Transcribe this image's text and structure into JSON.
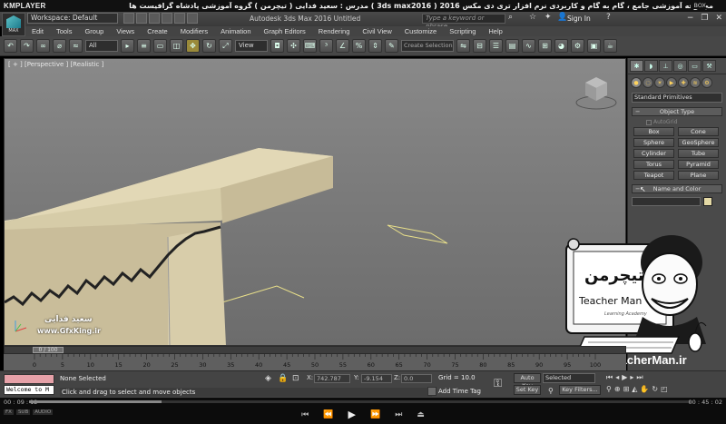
{
  "player": {
    "brand": "KMPLAYER",
    "title": "مجموعه آموزشی جامع ، گام به گام و کاربردی نرم افزار تری دی مکس 2016 ( 3ds max2016 )  مدرس : سعید فدایی ( تیچرمن ) گروه آموزشی پادشاه گرافیست ها",
    "time_current": "00 : 09 : 12",
    "time_total": "00 : 45 : 02",
    "progress_fraction": 0.2,
    "corner_label": "BOX",
    "controls": [
      "⏮",
      "⏪",
      "▶",
      "⏩",
      "⏭",
      "⏏"
    ],
    "left_badges": [
      "FX",
      "SUB",
      "AUDIO"
    ]
  },
  "app": {
    "window_title": "Autodesk 3ds Max 2016     Untitled",
    "workspace": "Workspace: Default",
    "help_search_placeholder": "Type a keyword or phrase",
    "sign_in": "Sign In",
    "window_controls": [
      "−",
      "❐",
      "✕"
    ],
    "logo_label": "MAX"
  },
  "menu": [
    "Edit",
    "Tools",
    "Group",
    "Views",
    "Create",
    "Modifiers",
    "Animation",
    "Graph Editors",
    "Rendering",
    "Civil View",
    "Customize",
    "Scripting",
    "Help"
  ],
  "toolbar": {
    "filter": "All",
    "ref_coord": "View",
    "selection_set": "Create Selection Se"
  },
  "viewport": {
    "label": "[ + ] [Perspective ] [Realistic ]",
    "watermark_name": "سعید فدایی",
    "watermark_site": "www.GfxKing.ir"
  },
  "command_panel": {
    "category": "Standard Primitives",
    "object_type_header": "Object Type",
    "autogrid_label": "AutoGrid",
    "objects": [
      "Box",
      "Cone",
      "Sphere",
      "GeoSphere",
      "Cylinder",
      "Tube",
      "Torus",
      "Pyramid",
      "Teapot",
      "Plane"
    ],
    "name_color_header": "Name and Color",
    "color": "#e4d9a5"
  },
  "badge": {
    "site": "www.TeacherMan.ir",
    "name_en": "Teacher Man",
    "name_fa": "تیچرمن",
    "tagline": "Learning Academy"
  },
  "timeline": {
    "frame_label": "0 / 100",
    "ticks": [
      0,
      5,
      10,
      15,
      20,
      25,
      30,
      35,
      40,
      45,
      50,
      55,
      60,
      65,
      70,
      75,
      80,
      85,
      90,
      95,
      100
    ]
  },
  "status": {
    "listener_text": "Welcome to M",
    "selection": "None Selected",
    "prompt": "Click and drag to select and move objects",
    "x_label": "X:",
    "x_value": "742.787",
    "y_label": "Y:",
    "y_value": "-9.154",
    "z_label": "Z:",
    "z_value": "0.0",
    "grid": "Grid = 10.0",
    "add_time_tag": "Add Time Tag",
    "auto_key": "Auto Key",
    "set_key": "Set Key",
    "selected": "Selected",
    "key_filters": "Key Filters..."
  }
}
